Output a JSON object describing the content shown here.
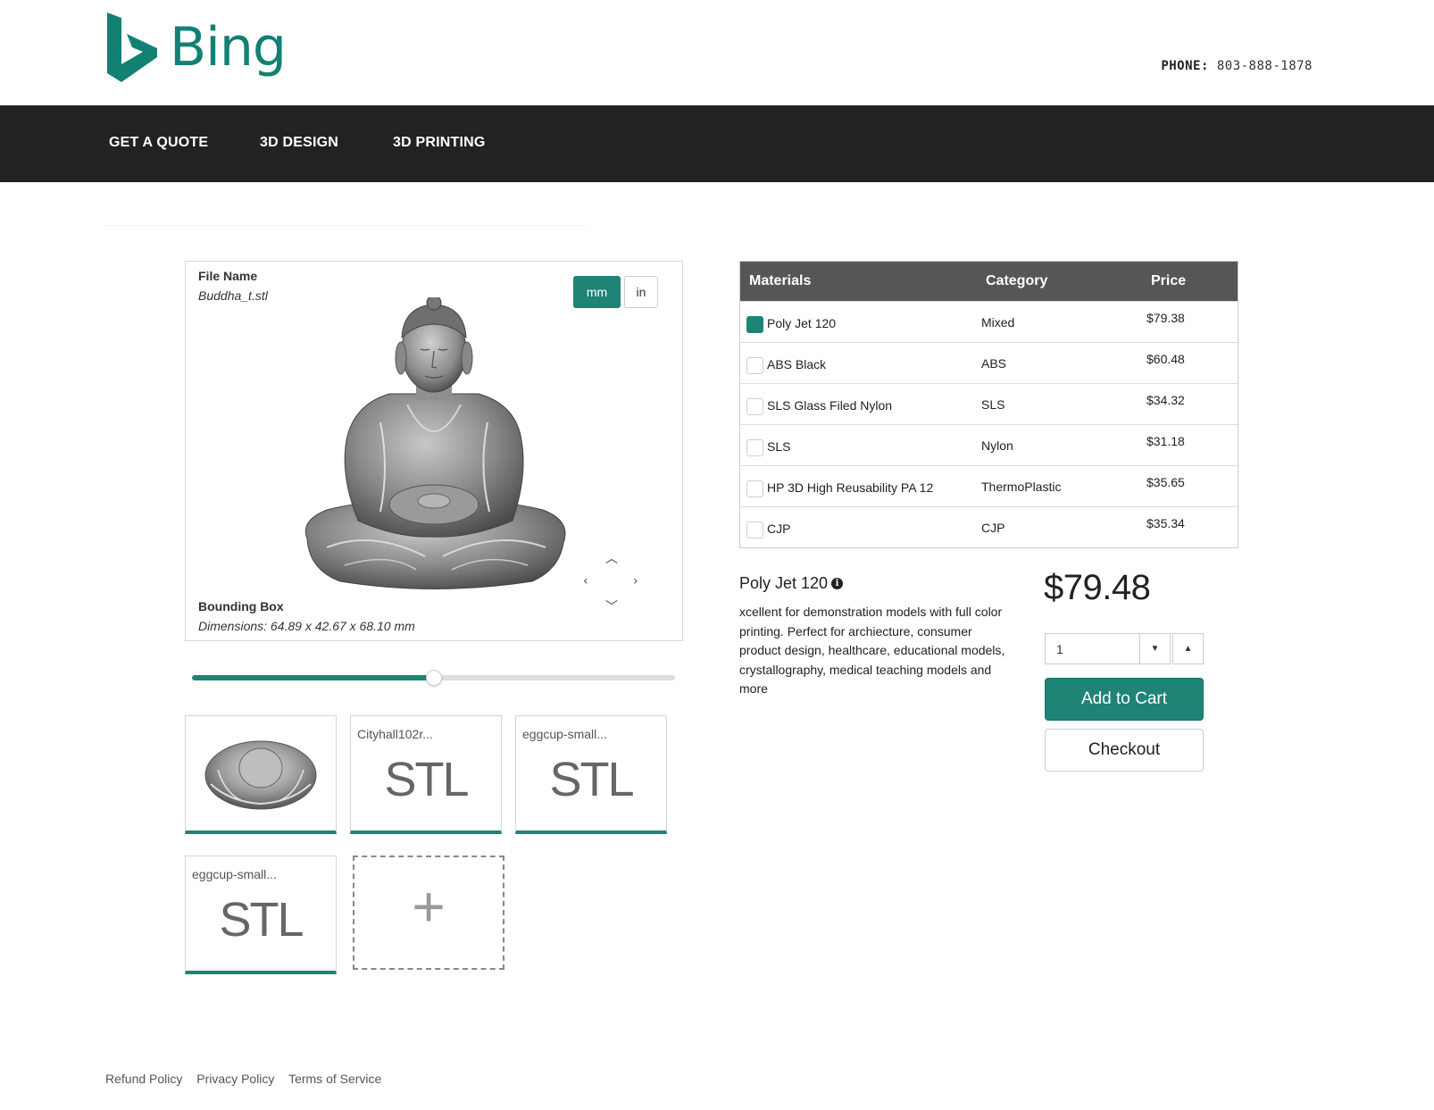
{
  "header": {
    "brand": "Bing",
    "phone_label": "PHONE:",
    "phone_number": "803-888-1878"
  },
  "nav": {
    "items": [
      {
        "label": "GET A QUOTE"
      },
      {
        "label": "3D DESIGN"
      },
      {
        "label": "3D PRINTING"
      }
    ]
  },
  "viewer": {
    "file_name_label": "File Name",
    "file_name": "Buddha_t.stl",
    "units": {
      "mm": "mm",
      "in": "in",
      "selected": "mm"
    },
    "bounding_box_label": "Bounding Box",
    "dimensions": "Dimensions: 64.89 x 42.67 x 68.10 mm",
    "zoom_fraction": 0.5
  },
  "files": [
    {
      "name": "",
      "thumb": "buddha-preview"
    },
    {
      "name": "Cityhall102r...",
      "thumb": "STL"
    },
    {
      "name": "eggcup-small...",
      "thumb": "STL"
    },
    {
      "name": "eggcup-small...",
      "thumb": "STL"
    }
  ],
  "add_file_symbol": "+",
  "materials_table": {
    "headers": {
      "materials": "Materials",
      "category": "Category",
      "price": "Price"
    },
    "rows": [
      {
        "name": "Poly Jet 120",
        "category": "Mixed",
        "price": "$79.38",
        "checked": true
      },
      {
        "name": "ABS Black",
        "category": "ABS",
        "price": "$60.48",
        "checked": false
      },
      {
        "name": "SLS Glass Filed Nylon",
        "category": "SLS",
        "price": "$34.32",
        "checked": false
      },
      {
        "name": "SLS",
        "category": "Nylon",
        "price": "$31.18",
        "checked": false
      },
      {
        "name": "HP 3D High Reusability PA 12",
        "category": "ThermoPlastic",
        "price": "$35.65",
        "checked": false
      },
      {
        "name": "CJP",
        "category": "CJP",
        "price": "$35.34",
        "checked": false
      }
    ]
  },
  "detail": {
    "material_name": "Poly Jet 120",
    "info_icon": "info-icon",
    "description": "xcellent for demonstration models with full color printing. Perfect for archiecture, consumer product design, healthcare, educational models, crystallography, medical teaching models and more",
    "price": "$79.48",
    "quantity": "1",
    "add_to_cart": "Add to Cart",
    "checkout": "Checkout"
  },
  "footer": {
    "links": [
      "Refund Policy",
      "Privacy Policy",
      "Terms of Service"
    ]
  },
  "colors": {
    "accent": "#1f8376",
    "nav_bg": "#222222",
    "table_header_bg": "#565656",
    "brand": "#138074"
  }
}
